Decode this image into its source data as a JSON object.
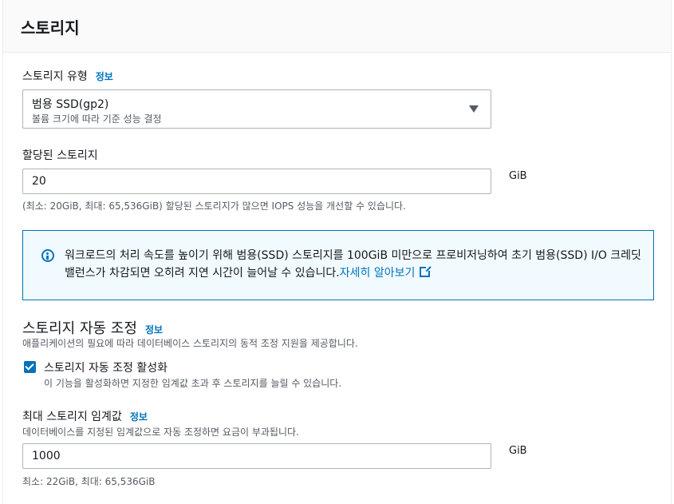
{
  "panel": {
    "title": "스토리지"
  },
  "storage_type": {
    "label": "스토리지 유형",
    "info": "정보",
    "selected": "범용 SSD(gp2)",
    "selected_description": "볼륨 크기에 따라 기준 성능 결정"
  },
  "allocated_storage": {
    "label": "할당된 스토리지",
    "value": "20",
    "unit": "GiB",
    "hint": "(최소: 20GiB, 최대: 65,536GiB) 할당된 스토리지가 많으면 IOPS 성능을 개선할 수 있습니다."
  },
  "alert": {
    "text": "워크로드의 처리 속도를 높이기 위해 범용(SSD) 스토리지를 100GiB 미만으로 프로비저닝하여 초기 범용(SSD) I/O 크레딧 밸런스가 차감되면 오히려 지연 시간이 늘어날 수 있습니다.",
    "link": "자세히 알아보기"
  },
  "autoscaling": {
    "title": "스토리지 자동 조정",
    "info": "정보",
    "description": "애플리케이션의 필요에 따라 데이터베이스 스토리지의 동적 조정 지원을 제공합니다.",
    "checkbox_label": "스토리지 자동 조정 활성화",
    "checkbox_checked": true,
    "checkbox_description": "이 기능을 활성화하면 지정한 임계값 초과 후 스토리지를 늘릴 수 있습니다."
  },
  "max_threshold": {
    "label": "최대 스토리지 임계값",
    "info": "정보",
    "description": "데이터베이스를 지정된 임계값으로 자동 조정하면 요금이 부과됩니다.",
    "value": "1000",
    "unit": "GiB",
    "hint": "최소: 22GiB, 최대: 65,536GiB"
  },
  "colors": {
    "accent": "#0073bb",
    "alert_background": "#f1faff",
    "header_background": "#fafafa"
  }
}
